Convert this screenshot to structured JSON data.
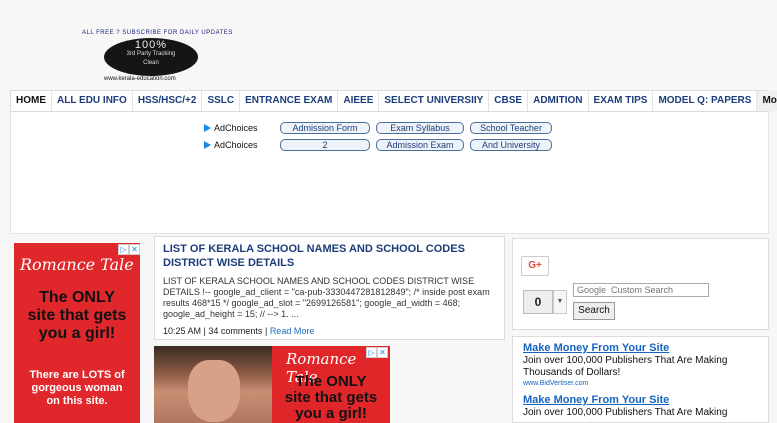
{
  "logo": {
    "top_text": "ALL FREE ? SUBSCRIBE FOR DAILY UPDATES",
    "badge": "100%",
    "line1": "3rd Party Tracking",
    "line2": "Clean",
    "bottom_text": "www.kerala-education.com"
  },
  "nav": {
    "items": [
      "HOME",
      "ALL EDU INFO",
      "HSS/HSC/+2",
      "SSLC",
      "ENTRANCE EXAM",
      "AIEEE",
      "SELECT UNIVERSIIY",
      "CBSE",
      "ADMITION",
      "EXAM TIPS",
      "MODEL Q: PAPERS",
      "More"
    ]
  },
  "adchoices": {
    "label": "AdChoices",
    "row1": [
      "Admission Form",
      "Exam Syllabus",
      "School Teacher"
    ],
    "row2": [
      "2",
      "Admission Exam",
      "And University"
    ]
  },
  "left_ad": {
    "brand": "Romance Tale",
    "headline": [
      "The ONLY",
      "site that gets",
      "you a girl!"
    ],
    "sub": [
      "There are LOTS of",
      "gorgeous woman",
      "on this site."
    ]
  },
  "post": {
    "title": "LIST OF KERALA SCHOOL NAMES AND SCHOOL CODES DISTRICT WISE DETAILS",
    "body": "LIST OF KERALA SCHOOL NAMES AND SCHOOL CODES DISTRICT WISE DETAILS !-- google_ad_client = \"ca-pub-3330447281812849\"; /* inside post exam results 468*15 */ google_ad_slot = \"2699126581\"; google_ad_width = 468; google_ad_height = 15; // --> 1. ...",
    "time": "10:25 AM",
    "sep": "|",
    "comments": "34 comments",
    "read_more": "Read More"
  },
  "bottom_ad": {
    "brand": "Romance Tale",
    "headline": [
      "The ONLY",
      "site that gets",
      "you a girl!"
    ]
  },
  "sidebar": {
    "gplus": "G+",
    "count": "0",
    "search_placeholder": "Google  Custom Search",
    "search_button": "Search"
  },
  "bidvertiser": [
    {
      "title": "Make Money From Your Site",
      "text": "Join over 100,000 Publishers That Are Making Thousands of Dollars!",
      "url": "www.BidVertiser.com"
    },
    {
      "title": "Make Money From Your Site",
      "text": "Join over 100,000 Publishers That Are Making",
      "url": ""
    }
  ],
  "colors": {
    "nav_link": "#1c3d7a",
    "ad_red": "#e0282c",
    "bv_link": "#1565c0"
  }
}
